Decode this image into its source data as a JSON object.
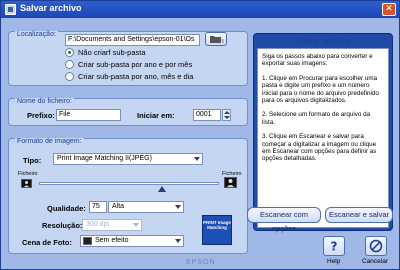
{
  "window": {
    "title": "Salvar archivo",
    "close_glyph": "✕",
    "footer_brand": "EPSON"
  },
  "location": {
    "section": "Localização:",
    "path_value": "F:\\Documents and Settings\\epson-01\\Os",
    "options": [
      "Não criarf sub-pasta",
      "Criar sub-pasta por ano e por mês",
      "Criar sub-pasta por ano, mês e dia"
    ],
    "selected_index": 0
  },
  "filename": {
    "section": "Nome do ficheiro:",
    "prefix_label": "Prefixo:",
    "prefix_value": "File",
    "start_label": "Iniciar em:",
    "start_value": "0001"
  },
  "format": {
    "section": "Formato de imagem:",
    "type_label": "Tipo:",
    "type_value": "Print Image Matching II(JPEG)",
    "file_left": "Ficheiro",
    "file_right": "Ficheiro",
    "quality_label": "Qualidade:",
    "quality_value": "75",
    "quality_option": "Alta",
    "resolution_label": "Resolução:",
    "resolution_value": "300 dpi",
    "scene_label": "Cena de Foto:",
    "scene_value": "Sem efeito",
    "pim_badge": "PRINT Image Matching"
  },
  "help_panel": {
    "title": "Salvar archivo",
    "p1": "Siga os passos abaixo para converter e exportar suas imagens:",
    "p2": "1. Clique em Procurar para escolher uma pasta e digite um prefixo e um número inicial para o nome do arquivo predefinido para os arquivos digitalizados.",
    "p3": "2. Selecione um formato de arquivo da lista.",
    "p4": "3. Clique em Escanear e salvar para começar a digitalizar a imagem ou clique em Escanear com opções para definir as opções detalhadas."
  },
  "actions": {
    "scan_options": "Escanear com opções",
    "scan_save": "Escanear e salvar",
    "help": "Help",
    "cancel": "Cancelar"
  },
  "colors": {
    "title_bar": "#1d46b3",
    "panel": "#c5d6f3",
    "help_frame": "#1f4aa8"
  }
}
